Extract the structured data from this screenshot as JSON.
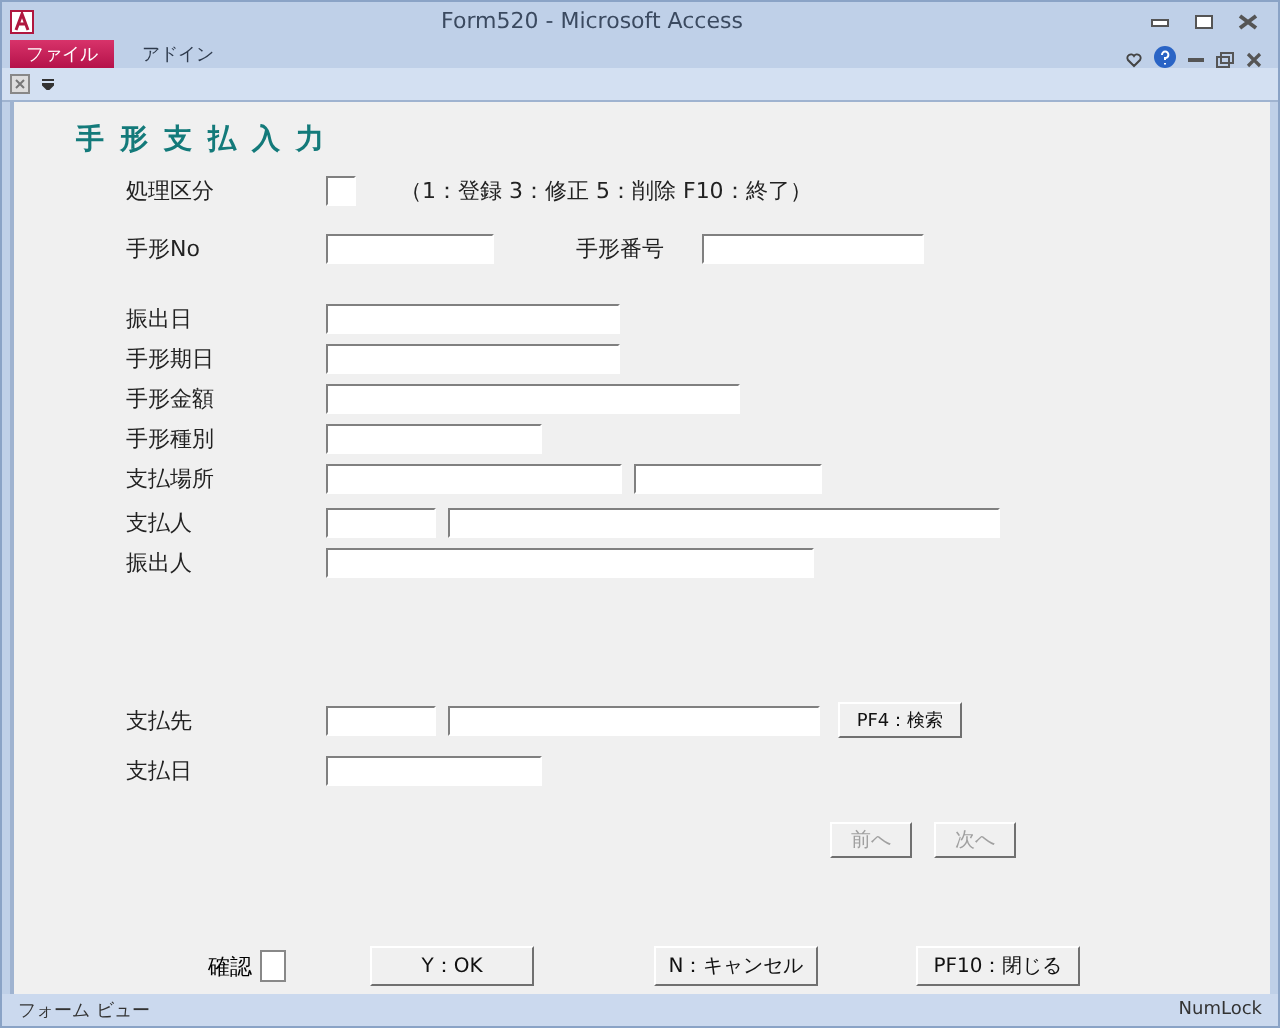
{
  "window": {
    "title": "Form520 - Microsoft Access"
  },
  "ribbon": {
    "tabs": [
      {
        "label": "ファイル",
        "selected": true
      },
      {
        "label": "アドイン",
        "selected": false
      }
    ]
  },
  "form": {
    "title": "手形支払入力",
    "rows": [
      {
        "label": "処理区分",
        "fields": [
          {
            "kind": "code"
          }
        ],
        "note": "（1：登録 3：修正 5：削除 F10：終了）"
      },
      {
        "label": "手形No",
        "fields": [
          {
            "kind": "text"
          }
        ],
        "secondary_label": "手形番号",
        "secondary_fields": [
          {
            "kind": "text"
          }
        ]
      },
      {
        "label": "振出日",
        "fields": [
          {
            "kind": "text"
          }
        ]
      },
      {
        "label": "手形期日",
        "fields": [
          {
            "kind": "text"
          }
        ]
      },
      {
        "label": "手形金額",
        "fields": [
          {
            "kind": "text"
          }
        ]
      },
      {
        "label": "手形種別",
        "fields": [
          {
            "kind": "text"
          }
        ]
      },
      {
        "label": "支払場所",
        "fields": [
          {
            "kind": "text"
          },
          {
            "kind": "text"
          }
        ]
      },
      {
        "label": "支払人",
        "fields": [
          {
            "kind": "text"
          },
          {
            "kind": "text"
          }
        ]
      },
      {
        "label": "振出人",
        "fields": [
          {
            "kind": "text"
          }
        ]
      },
      {
        "label": "支払先",
        "fields": [
          {
            "kind": "text"
          },
          {
            "kind": "text"
          }
        ],
        "button": "PF4：検索"
      },
      {
        "label": "支払日",
        "fields": [
          {
            "kind": "text"
          }
        ]
      }
    ],
    "nav_buttons": [
      {
        "label": "前へ",
        "disabled": true
      },
      {
        "label": "次へ",
        "disabled": true
      }
    ],
    "confirm": {
      "label": "確認",
      "checked": false
    },
    "buttons": [
      "Y：OK",
      "N：キャンセル",
      "PF10：閉じる"
    ]
  },
  "status_bar": {
    "left": "フォーム ビュー",
    "right": "NumLock"
  }
}
